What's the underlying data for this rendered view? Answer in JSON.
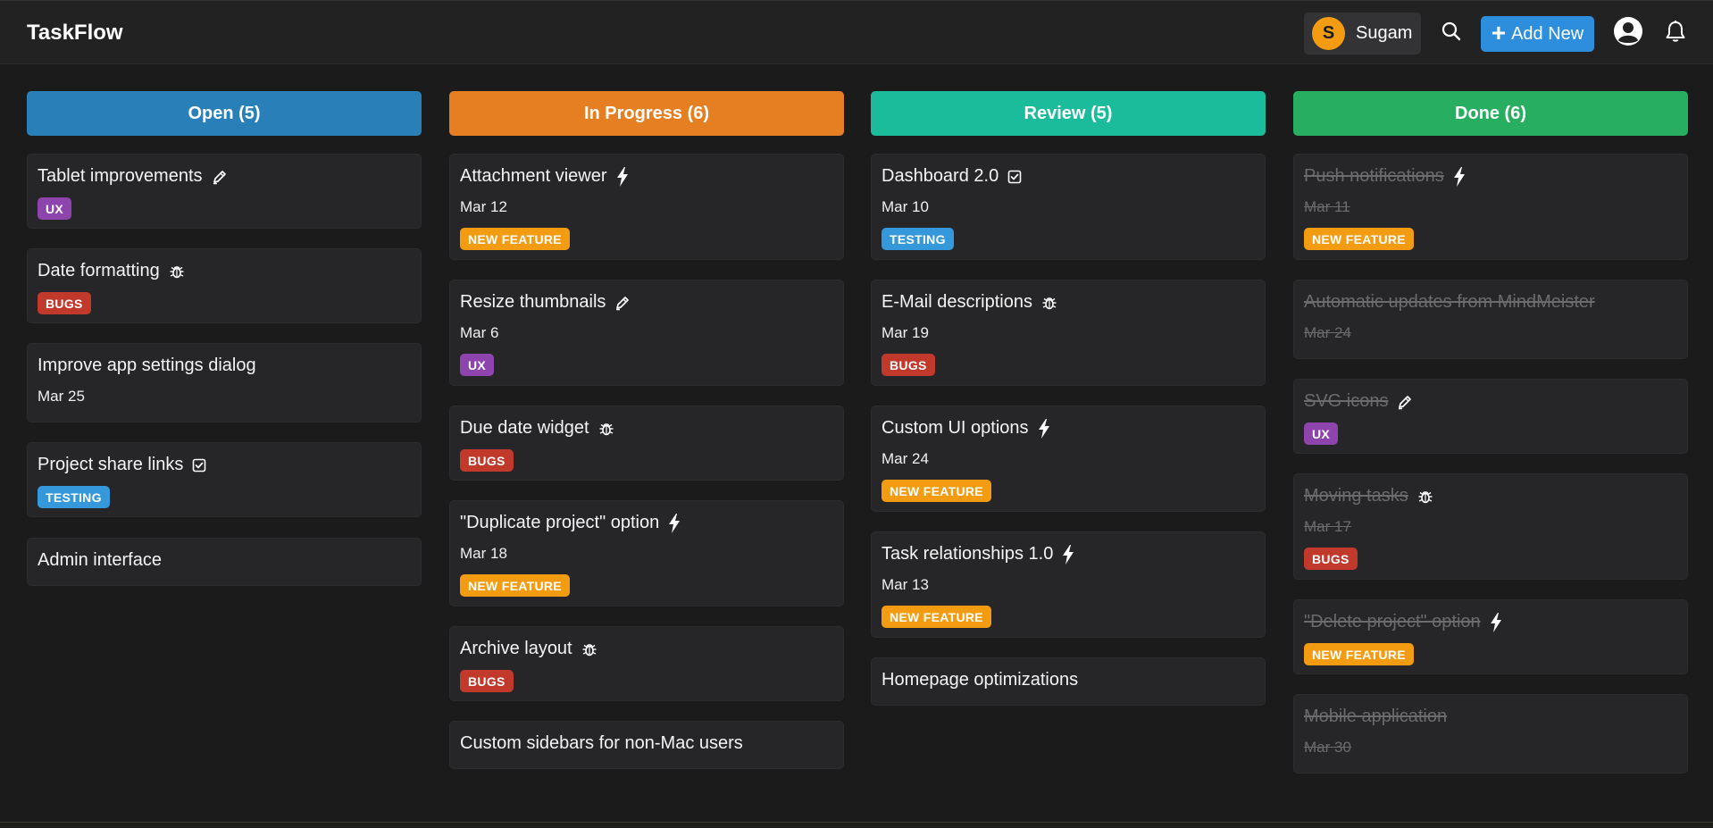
{
  "app": {
    "title": "TaskFlow"
  },
  "user": {
    "initial": "S",
    "name": "Sugam"
  },
  "toolbar": {
    "add_label": "Add New"
  },
  "columns": [
    {
      "title": "Open (5)",
      "color": "#2980b9",
      "cards": [
        {
          "title": "Tablet improvements",
          "icon": "pen-icon",
          "date": "",
          "tag": "UX"
        },
        {
          "title": "Date formatting",
          "icon": "bug-icon",
          "date": "",
          "tag": "BUGS"
        },
        {
          "title": "Improve app settings dialog",
          "icon": "",
          "date": "Mar 25",
          "tag": ""
        },
        {
          "title": "Project share links",
          "icon": "checkbox-icon",
          "date": "",
          "tag": "TESTING"
        },
        {
          "title": "Admin interface",
          "icon": "",
          "date": "",
          "tag": ""
        }
      ]
    },
    {
      "title": "In Progress (6)",
      "color": "#e67e22",
      "cards": [
        {
          "title": "Attachment viewer",
          "icon": "bolt-icon",
          "date": "Mar 12",
          "tag": "NEW FEATURE"
        },
        {
          "title": "Resize thumbnails",
          "icon": "pen-icon",
          "date": "Mar 6",
          "tag": "UX"
        },
        {
          "title": "Due date widget",
          "icon": "bug-icon",
          "date": "",
          "tag": "BUGS"
        },
        {
          "title": "\"Duplicate project\" option",
          "icon": "bolt-icon",
          "date": "Mar 18",
          "tag": "NEW FEATURE"
        },
        {
          "title": "Archive layout",
          "icon": "bug-icon",
          "date": "",
          "tag": "BUGS"
        },
        {
          "title": "Custom sidebars for non-Mac users",
          "icon": "",
          "date": "",
          "tag": ""
        }
      ]
    },
    {
      "title": "Review (5)",
      "color": "#1abc9c",
      "cards": [
        {
          "title": "Dashboard 2.0",
          "icon": "checkbox-icon",
          "date": "Mar 10",
          "tag": "TESTING"
        },
        {
          "title": "E-Mail descriptions",
          "icon": "bug-icon",
          "date": "Mar 19",
          "tag": "BUGS"
        },
        {
          "title": "Custom UI options",
          "icon": "bolt-icon",
          "date": "Mar 24",
          "tag": "NEW FEATURE"
        },
        {
          "title": "Task relationships 1.0",
          "icon": "bolt-icon",
          "date": "Mar 13",
          "tag": "NEW FEATURE"
        },
        {
          "title": "Homepage optimizations",
          "icon": "",
          "date": "",
          "tag": ""
        }
      ]
    },
    {
      "title": "Done (6)",
      "color": "#27ae60",
      "cards": [
        {
          "title": "Push notifications",
          "icon": "bolt-icon",
          "date": "Mar 11",
          "tag": "NEW FEATURE"
        },
        {
          "title": "Automatic updates from MindMeister",
          "icon": "",
          "date": "Mar 24",
          "tag": ""
        },
        {
          "title": "SVG icons",
          "icon": "pen-icon",
          "date": "",
          "tag": "UX"
        },
        {
          "title": "Moving tasks",
          "icon": "bug-icon",
          "date": "Mar 17",
          "tag": "BUGS"
        },
        {
          "title": "\"Delete project\" option",
          "icon": "bolt-icon",
          "date": "",
          "tag": "NEW FEATURE"
        },
        {
          "title": "Mobile application",
          "icon": "",
          "date": "Mar 30",
          "tag": ""
        }
      ]
    }
  ],
  "tag_colors": {
    "UX": "#8e44ad",
    "BUGS": "#c0392b",
    "TESTING": "#3498db",
    "NEW FEATURE": "#f39c12"
  }
}
